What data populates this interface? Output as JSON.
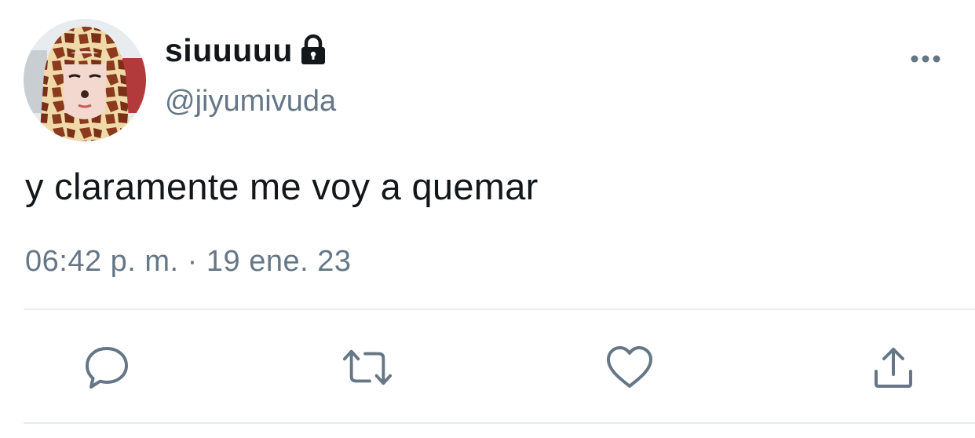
{
  "user": {
    "display_name": "siuuuuu",
    "handle": "@jiyumivuda",
    "protected_icon": "lock-icon",
    "avatar_icon": "giraffe-costume-avatar"
  },
  "tweet": {
    "text": "y claramente me voy a quemar",
    "timestamp": "06:42 p. m. · 19 ene. 23"
  },
  "actions": [
    {
      "name": "reply",
      "icon": "comment-icon"
    },
    {
      "name": "retweet",
      "icon": "retweet-icon"
    },
    {
      "name": "like",
      "icon": "heart-icon"
    },
    {
      "name": "share",
      "icon": "share-icon"
    }
  ],
  "colors": {
    "text_primary": "#14171a",
    "text_secondary": "#657786",
    "icon": "#657786",
    "divider": "#e6ecf0"
  }
}
